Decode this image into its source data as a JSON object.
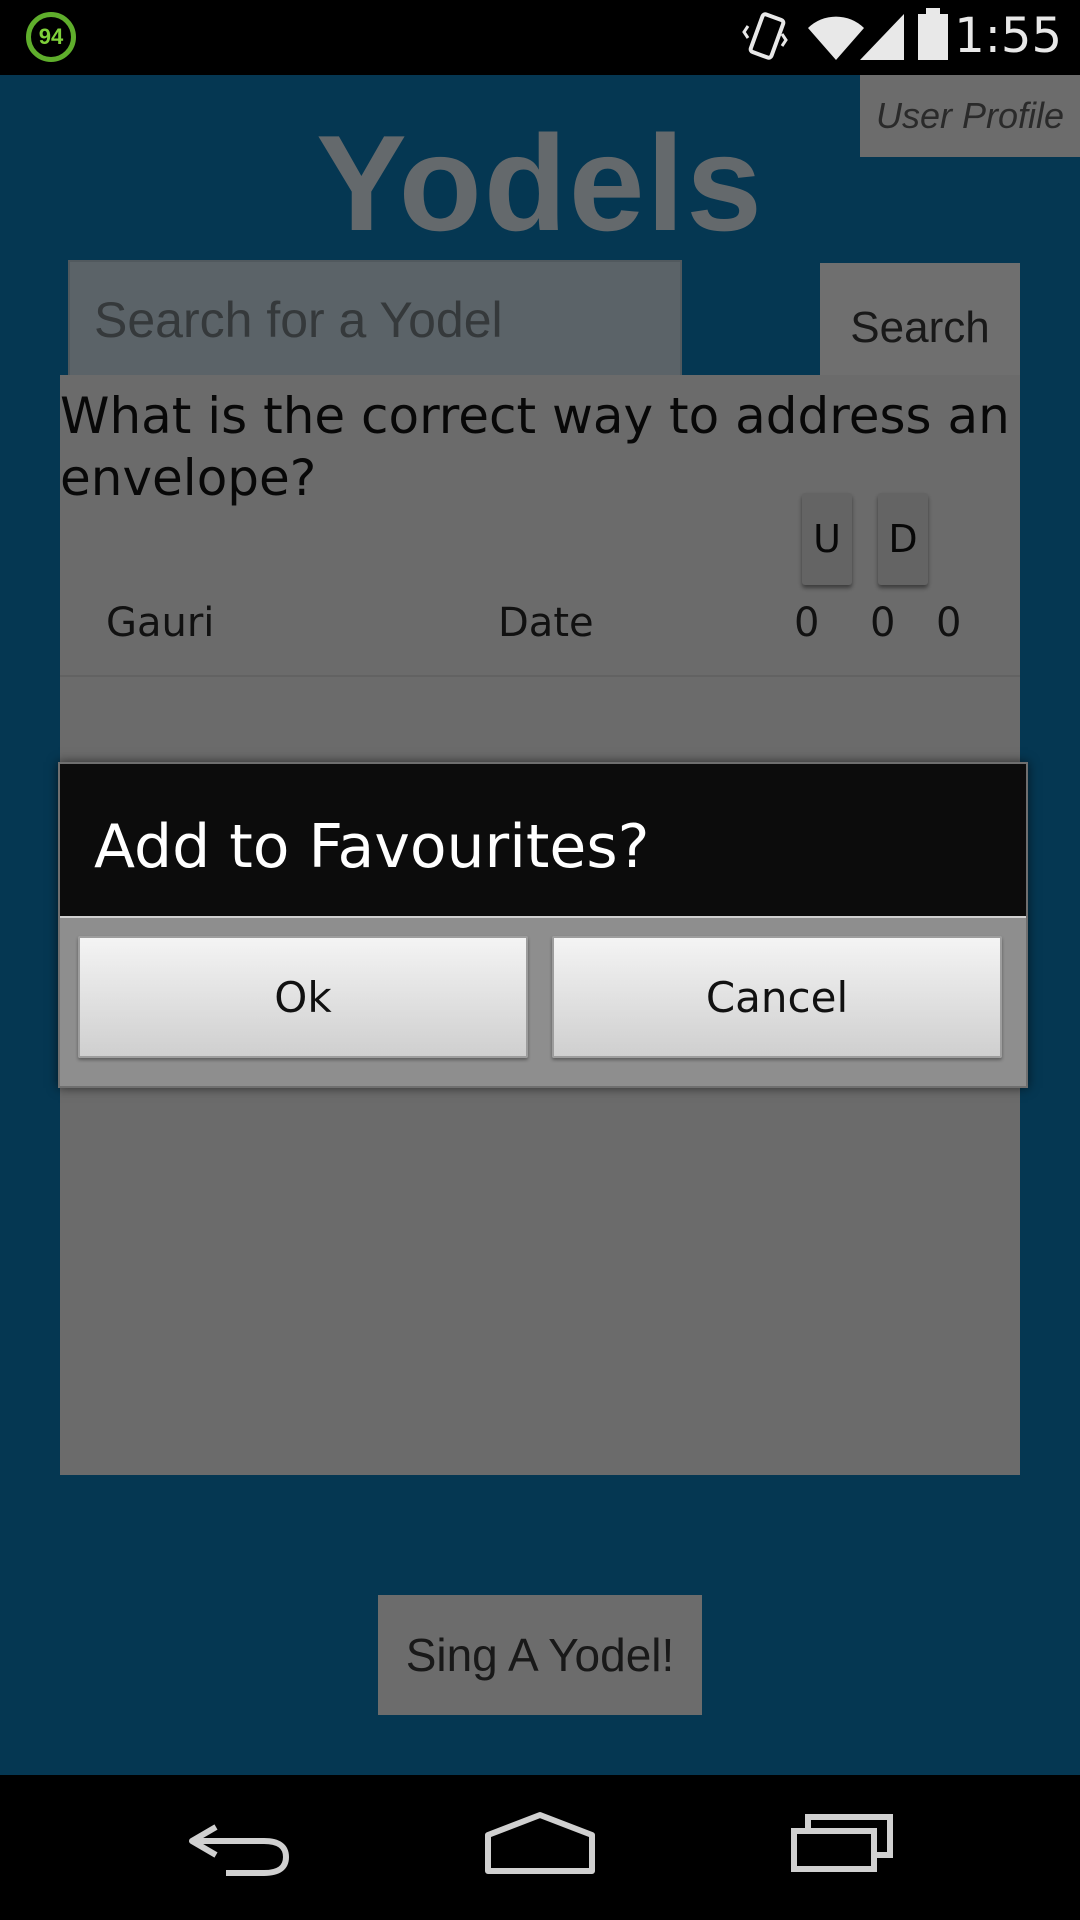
{
  "status_bar": {
    "badge": "94",
    "time": "1:55",
    "icons": [
      "vibrate-icon",
      "wifi-icon",
      "signal-icon",
      "battery-icon"
    ]
  },
  "app": {
    "title": "Yodels",
    "user_profile_label": "User Profile",
    "search": {
      "placeholder": "Search for a Yodel",
      "button_label": "Search"
    },
    "list": [
      {
        "question": "What is the correct way to address an envelope?",
        "up_label": "U",
        "down_label": "D",
        "author": "Gauri",
        "date": "Date",
        "counts": [
          "0",
          "0",
          "0"
        ]
      }
    ],
    "sing_button_label": "Sing A Yodel!"
  },
  "dialog": {
    "title": "Add to Favourites?",
    "ok_label": "Ok",
    "cancel_label": "Cancel"
  },
  "nav": {
    "icons": [
      "back-icon",
      "home-icon",
      "recent-apps-icon"
    ]
  },
  "colors": {
    "app_background": "#0a6ea5",
    "dialog_header": "#0c0c0c",
    "badge": "#5fae2c"
  }
}
